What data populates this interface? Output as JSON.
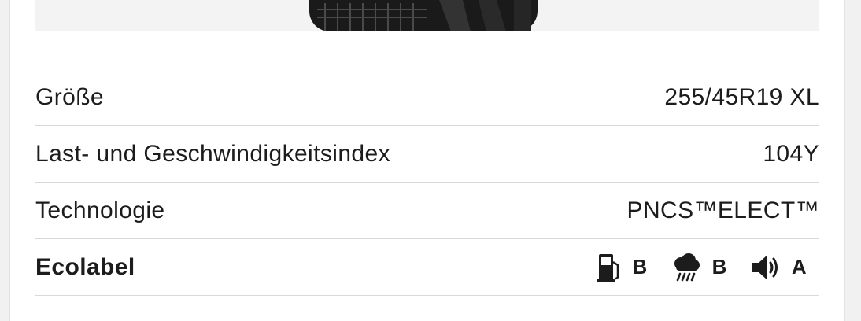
{
  "specs": {
    "rows": [
      {
        "label": "Größe",
        "value": "255/45R19 XL"
      },
      {
        "label": "Last- und Geschwindigkeitsindex",
        "value": "104Y"
      },
      {
        "label": "Technologie",
        "value": "PNCS™ELECT™"
      }
    ],
    "ecolabel": {
      "label": "Ecolabel",
      "items": [
        {
          "icon": "fuel-pump-icon",
          "grade": "B"
        },
        {
          "icon": "rain-cloud-icon",
          "grade": "B"
        },
        {
          "icon": "speaker-icon",
          "grade": "A"
        }
      ]
    }
  }
}
